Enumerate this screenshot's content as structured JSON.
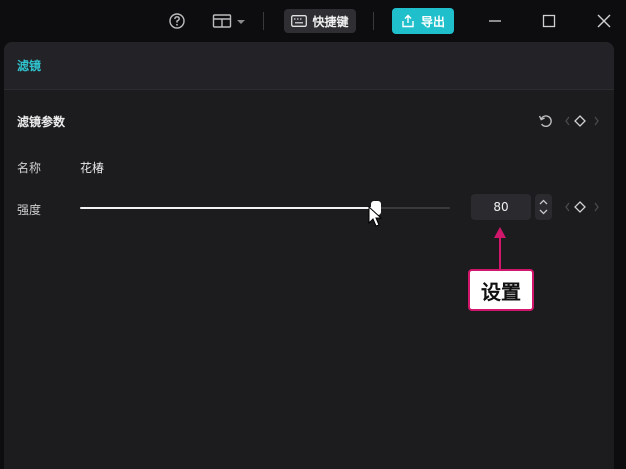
{
  "titlebar": {
    "shortcut_label": "快捷键",
    "export_label": "导出",
    "icons": [
      "help-icon",
      "layout-icon",
      "keyboard-icon",
      "upload-icon",
      "minimize-icon",
      "maximize-icon",
      "close-icon"
    ]
  },
  "panel": {
    "title": "滤镜",
    "section_title": "滤镜参数",
    "name_label": "名称",
    "name_value": "花椿",
    "strength_label": "强度",
    "strength_value": "80",
    "strength_fraction": 0.8
  },
  "annotation": {
    "label": "设置",
    "color": "#d0176b"
  },
  "colors": {
    "accent": "#1fc0cc",
    "panel_bg": "#1c1c1f",
    "window_bg": "#0d0d0f"
  }
}
